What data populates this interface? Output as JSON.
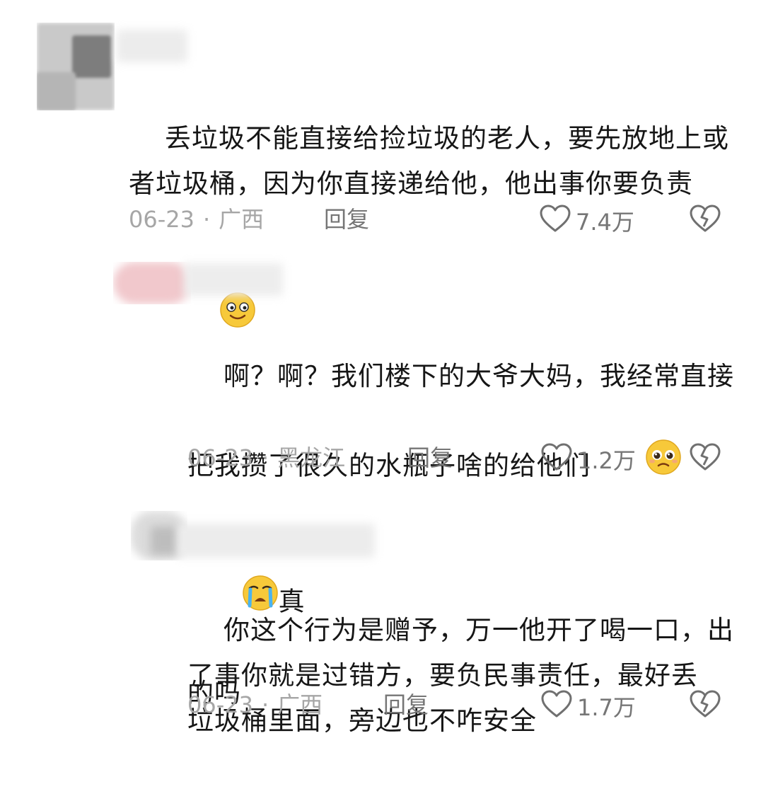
{
  "comments": [
    {
      "text": "丢垃圾不能直接给捡垃圾的老人，要先放地上或\n者垃圾桶，因为你直接递给他，他出事你要负责",
      "date": "06-23",
      "location": "广西",
      "reply_label": "回复",
      "likes": "7.4万"
    },
    {
      "text_line1": "啊？啊？我们楼下的大爷大妈，我经常直接",
      "text_line2_a": "把我攒了很久的水瓶子啥的给他们",
      "text_line2_b": "真",
      "text_line3": "的吗",
      "date": "06-23",
      "location": "黑龙江",
      "reply_label": "回复",
      "likes": "1.2万"
    },
    {
      "text": "你这个行为是赠予，万一他开了喝一口，出\n了事你就是过错方，要负民事责任，最好丢\n垃圾桶里面，旁边也不咋安全",
      "date": "06-23",
      "location": "广西",
      "reply_label": "回复",
      "likes": "1.7万"
    }
  ],
  "meta_separator": "·",
  "colors": {
    "text": "#161616",
    "meta": "#a6a6a6",
    "action": "#767676",
    "emoji_yellow": "#f7c93a"
  }
}
